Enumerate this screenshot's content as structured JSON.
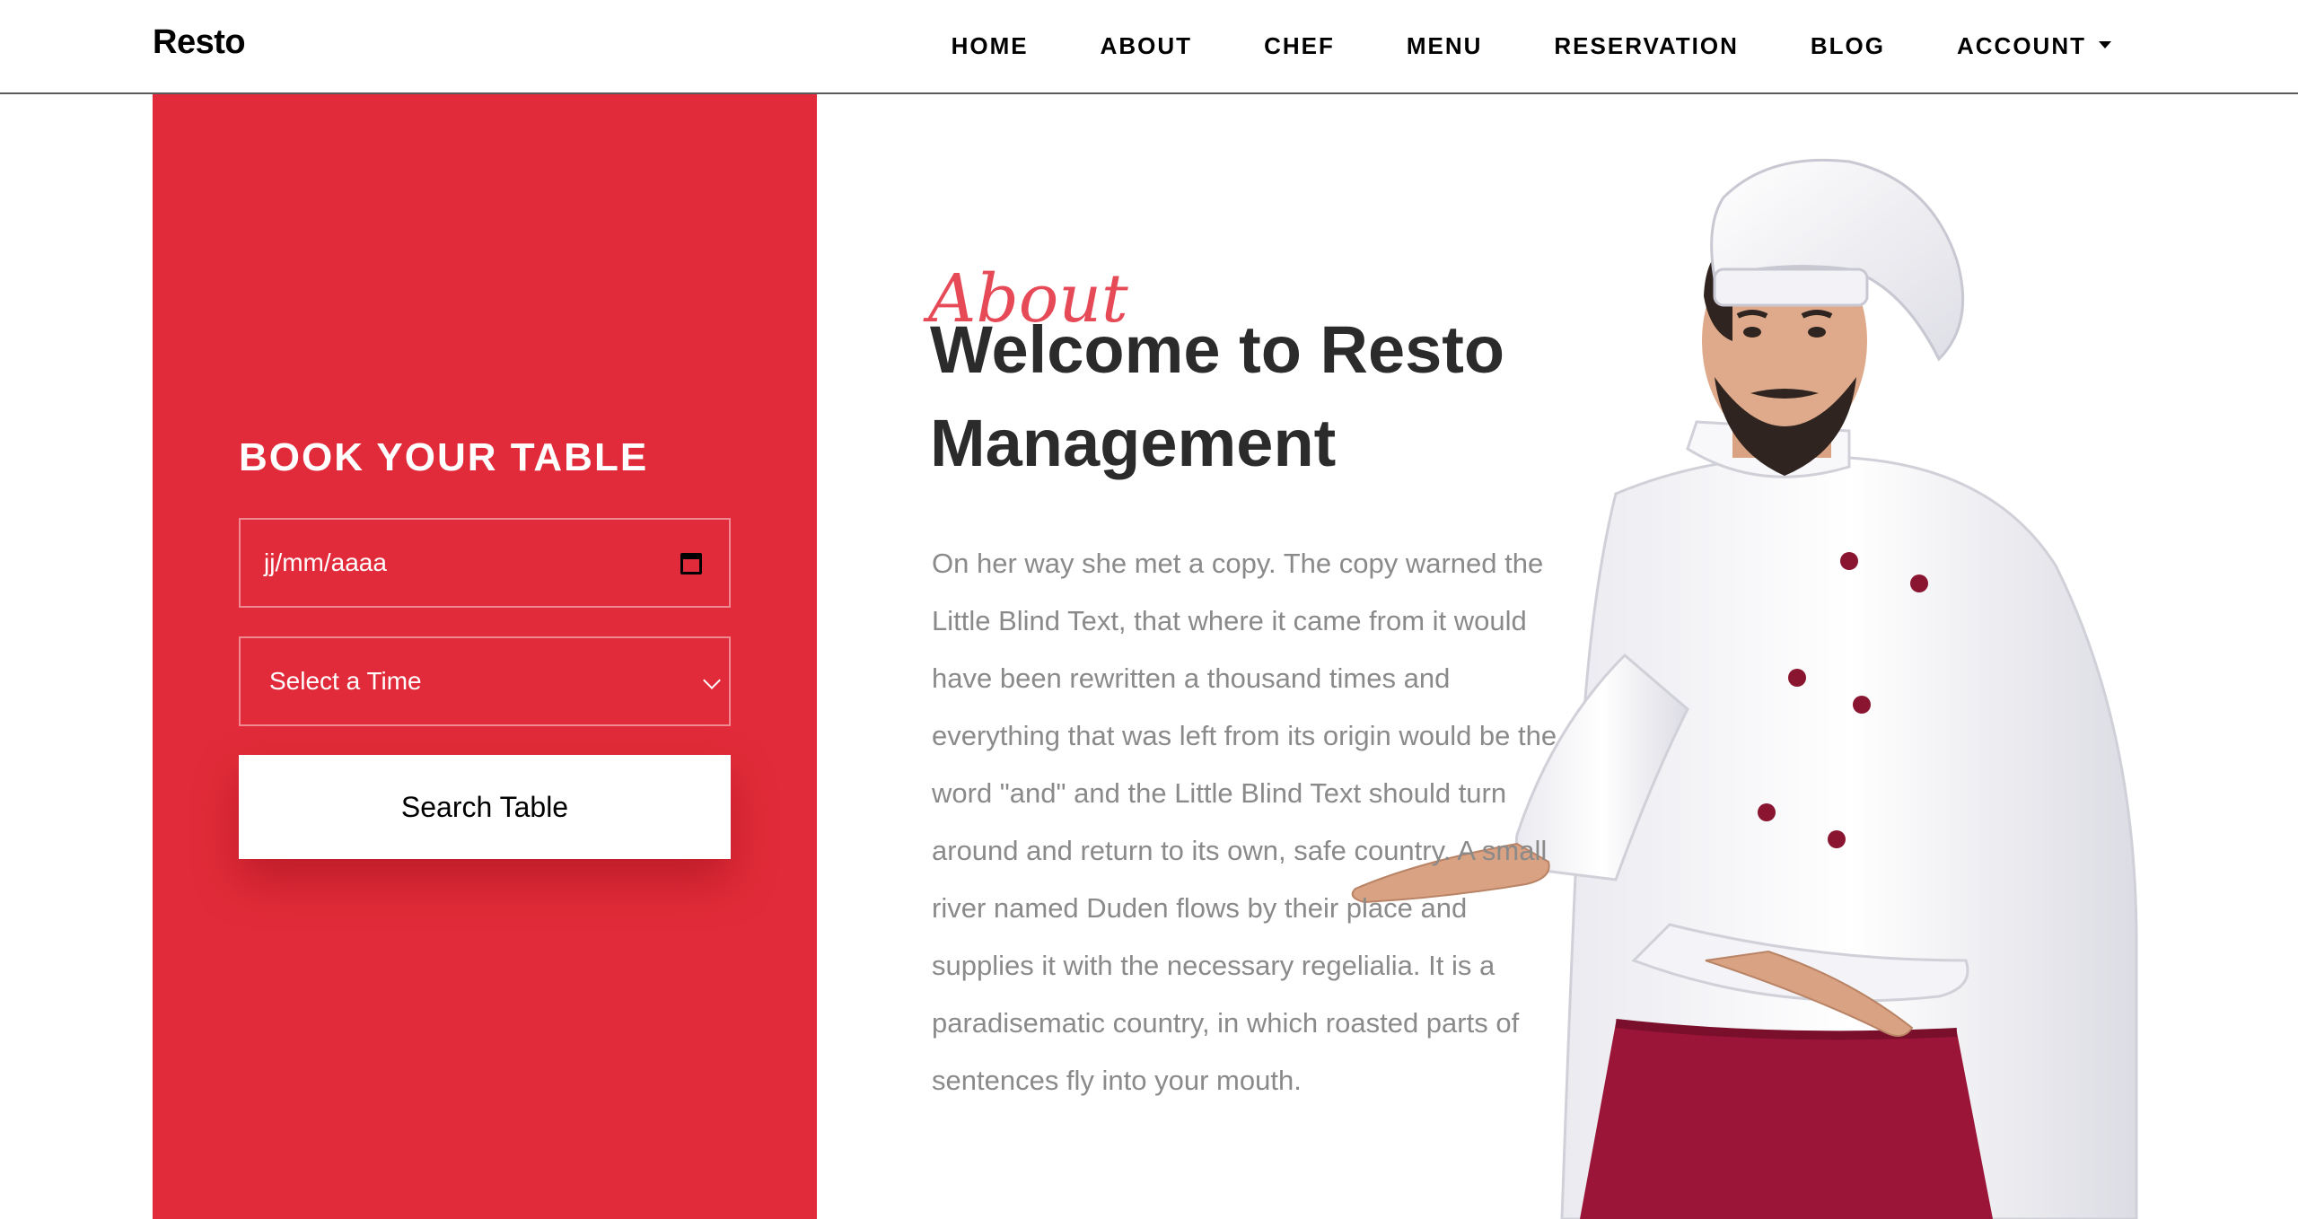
{
  "brand": {
    "name": "Resto"
  },
  "nav": {
    "items": [
      {
        "label": "HOME",
        "name": "nav-home"
      },
      {
        "label": "ABOUT",
        "name": "nav-about"
      },
      {
        "label": "CHEF",
        "name": "nav-chef"
      },
      {
        "label": "MENU",
        "name": "nav-menu"
      },
      {
        "label": "RESERVATION",
        "name": "nav-reservation"
      },
      {
        "label": "BLOG",
        "name": "nav-blog"
      },
      {
        "label": "ACCOUNT",
        "name": "nav-account",
        "dropdown": true
      }
    ]
  },
  "booking": {
    "title": "BOOK YOUR TABLE",
    "date_placeholder": "jj/mm/aaaa",
    "time_selected": "Select a Time",
    "search_label": "Search Table"
  },
  "about": {
    "subtitle": "About",
    "title": "Welcome to Resto Management",
    "body": "On her way she met a copy. The copy warned the Little Blind Text, that where it came from it would have been rewritten a thousand times and everything that was left from its origin would be the word \"and\" and the Little Blind Text should turn around and return to its own, safe country. A small river named Duden flows by their place and supplies it with the necessary regelialia. It is a paradisematic country, in which roasted parts of sentences fly into your mouth."
  },
  "colors": {
    "accent": "#e22b3a",
    "heading": "#2b2b2b",
    "body_text": "#8a8a8a",
    "apron": "#9b1538"
  },
  "icons": {
    "date_field": "calendar-icon",
    "time_field": "chevron-down-icon",
    "account": "caret-down-icon"
  }
}
